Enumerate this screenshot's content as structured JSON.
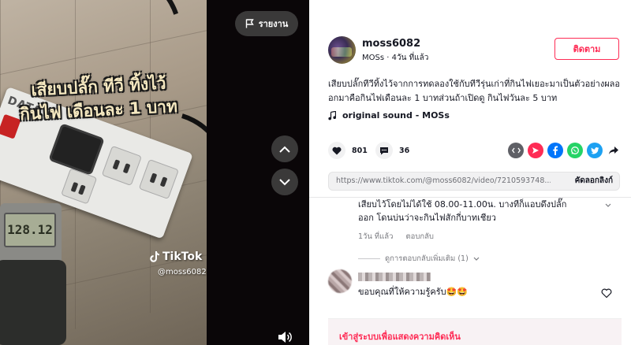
{
  "video": {
    "overlay_line1": "เสียบปลั๊ก ทีวี ทิ้งไว้",
    "overlay_line2": "กินไฟ เดือนละ 1 บาท",
    "strip_brand": "DATA",
    "meter_reading": "128.12",
    "watermark_brand": "TikTok",
    "watermark_handle": "@moss6082",
    "report_label": "รายงาน",
    "icons": {
      "report": "flag-icon",
      "up": "chevron-up-icon",
      "down": "chevron-down-icon",
      "volume": "volume-icon"
    }
  },
  "author": {
    "username": "moss6082",
    "nickname": "MOSs",
    "posted_ago": "4วัน ที่แล้ว",
    "separator": "·",
    "follow_label": "ติดตาม"
  },
  "caption": "เสียบปลั๊กทีวีทิ้งไว้จากการทดลองใช้กับทีวีรุ่นเก่าที่กินไฟเยอะมาเป็นตัวอย่างผลออกมาคือกินไฟเดือนละ 1 บาทส่วนถ้าเปิดดู กินไฟวันละ 5 บาท",
  "music": {
    "title": "original sound - MOSs",
    "icon": "music-note-icon"
  },
  "stats": {
    "likes": "801",
    "comments": "36"
  },
  "share_icons": [
    "embed-icon",
    "send-icon",
    "facebook-icon",
    "whatsapp-icon",
    "twitter-icon",
    "share-arrow-icon"
  ],
  "colors": {
    "accent": "#fe2c55",
    "embed": "#5f6066",
    "send": "#fe2c55",
    "facebook": "#0075fa",
    "whatsapp": "#25d366",
    "twitter": "#1da1f2"
  },
  "link": {
    "url": "https://www.tiktok.com/@moss6082/video/7210593748...",
    "copy_label": "คัดลอกลิงก์"
  },
  "comments": {
    "first_text_line1": "เสียบไว้โดยไม่ได้ใช้ 08.00-11.00น. บางทีก็แอบดึงปลั๊ก",
    "first_text_line2": "ออก โดนบ่นว่าจะกินไฟสักกี่บาทเชียว",
    "first_time": "1วัน ที่แล้ว",
    "reply_label": "ตอบกลับ",
    "more_replies": "ดูการตอบกลับเพิ่มเติม (1)",
    "second_text": "ขอบคุณที่ให้ความรู้ครับ🤩🤩"
  },
  "login_prompt": "เข้าสู่ระบบเพื่อแสดงความคิดเห็น"
}
